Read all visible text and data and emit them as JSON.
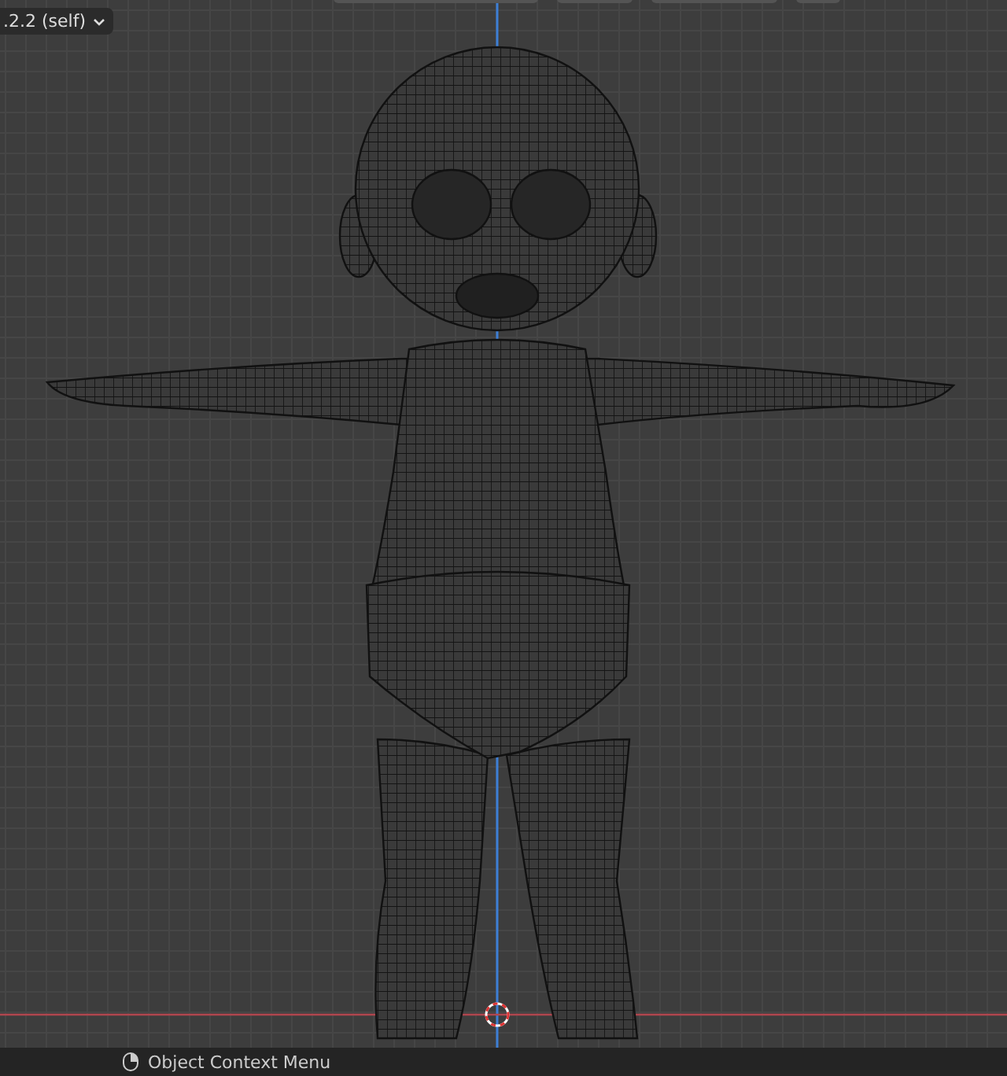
{
  "viewport": {
    "collection_dropdown": ".2.2 (self)"
  },
  "status_bar": {
    "hint": "Object Context Menu"
  }
}
